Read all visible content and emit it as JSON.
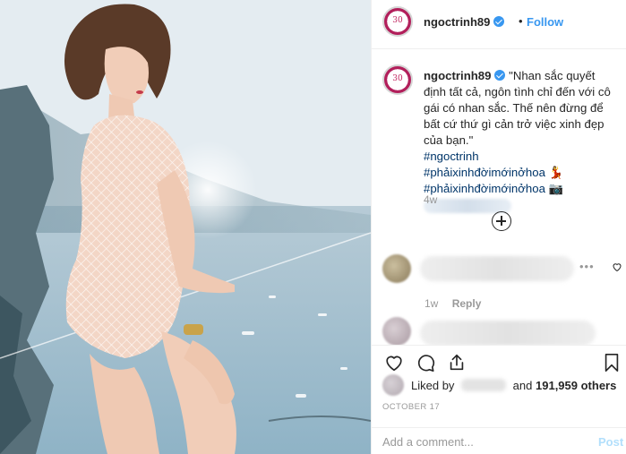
{
  "post": {
    "username": "ngoctrinh89",
    "dot": "•",
    "follow_label": "Follow",
    "avatar_label": "30"
  },
  "caption": {
    "username": "ngoctrinh89",
    "text": "\"Nhan sắc quyết định tất cả, ngôn tình chỉ đến với cô gái có nhan sắc. Thế nên đừng để bất cứ thứ gì cản trở việc xinh đẹp của bạn.\"",
    "hashtags": [
      "#ngoctrinh",
      "#phảixinhđờimớinởhoa 💃",
      "#phảixinhđờimớinởhoa 📷"
    ],
    "time": "4w"
  },
  "comments": [
    {
      "more": "•••",
      "time": "1w",
      "reply": "Reply"
    }
  ],
  "likes": {
    "prefix": "Liked by",
    "middle": "and",
    "count": "191,959 others"
  },
  "date": "OCTOBER 17",
  "add_comment": {
    "placeholder": "Add a comment...",
    "post_label": "Post"
  },
  "colors": {
    "accent": "#3897f0",
    "hashtag": "#003569",
    "muted": "#999999",
    "post_disabled": "#b2dffc"
  },
  "icons": {
    "like": "heart-icon",
    "comment": "comment-icon",
    "share": "share-icon",
    "save": "bookmark-icon",
    "load_more": "plus-circle-icon"
  }
}
